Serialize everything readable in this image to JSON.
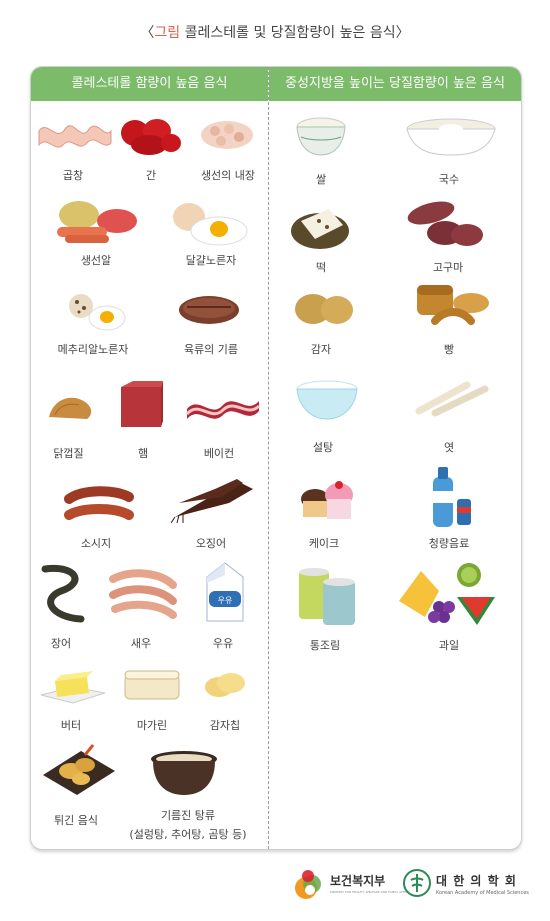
{
  "title": {
    "open": "〈",
    "accent": "그림",
    "text": " 콜레스테롤 및 당질함량이 높은 음식",
    "close": "〉"
  },
  "headers": {
    "left": "콜레스테롤 함량이 높음 음식",
    "right": "중성지방을 높이는 당질함량이 높은 음식"
  },
  "left_items": [
    "곱창",
    "간",
    "생선의 내장",
    "생선알",
    "달걀노른자",
    "메추리알노른자",
    "육류의 기름",
    "닭껍질",
    "햄",
    "베이컨",
    "소시지",
    "오징어",
    "장어",
    "새우",
    "우유",
    "버터",
    "마가린",
    "감자칩",
    "튀긴 음식",
    "기름진 탕류",
    "(설렁탕, 추어탕, 곰탕 등)"
  ],
  "right_items": [
    "쌀",
    "국수",
    "떡",
    "고구마",
    "감자",
    "빵",
    "설탕",
    "엿",
    "케이크",
    "청량음료",
    "통조림",
    "과일"
  ],
  "milk_label": "우유",
  "footer": {
    "ministry": "보건복지부",
    "society": "대 한 의 학 회",
    "society_en": "Korean Academy of Medical Sciences",
    "ministry_en": "MINISTRY FOR HEALTH, WELFARE AND FAMILY AFFAIRS"
  }
}
